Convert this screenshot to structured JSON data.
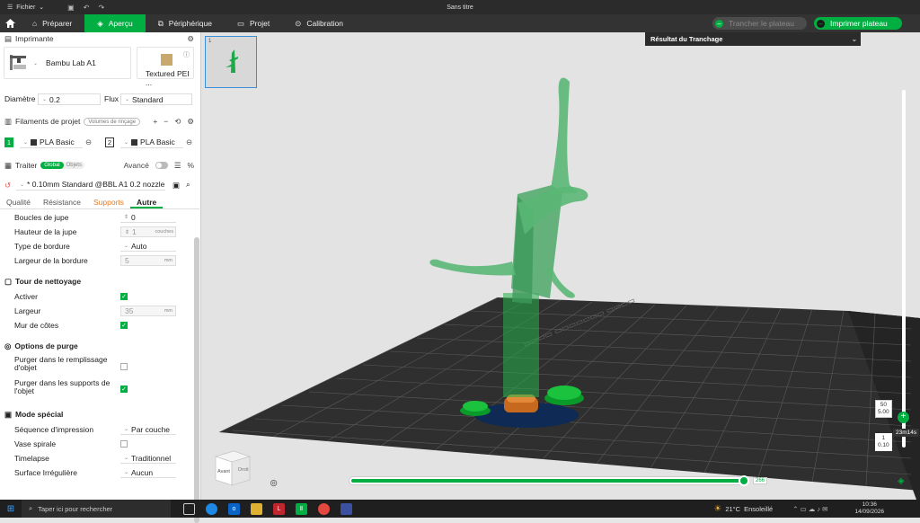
{
  "titlebar": {
    "file_menu": "Fichier",
    "window_title": "Sans titre"
  },
  "nav": {
    "tabs": [
      {
        "label": "Préparer",
        "icon": "prepare-icon"
      },
      {
        "label": "Aperçu",
        "icon": "preview-icon",
        "active": true
      },
      {
        "label": "Périphérique",
        "icon": "device-icon"
      },
      {
        "label": "Projet",
        "icon": "project-icon"
      },
      {
        "label": "Calibration",
        "icon": "calibration-icon"
      }
    ],
    "slice_button": "Trancher le plateau",
    "print_button": "Imprimer plateau"
  },
  "printer": {
    "section_title": "Imprimante",
    "printer_name": "Bambu Lab A1",
    "plate_name": "Textured PEI ...",
    "diameter_label": "Diamètre",
    "diameter_value": "0.2",
    "flow_label": "Flux",
    "flow_value": "Standard"
  },
  "filaments": {
    "section_title": "Filaments de projet",
    "flush_pill": "Volumes de rinçage",
    "slots": [
      {
        "num": "1",
        "name": "PLA Basic",
        "color": "#00ae42"
      },
      {
        "num": "2",
        "name": "PLA Basic",
        "color": "#ffffff"
      }
    ]
  },
  "process": {
    "section_title": "Traiter",
    "toggle_global": "Global",
    "toggle_objects": "Objets",
    "advanced_label": "Avancé",
    "profile": "* 0.10mm Standard @BBL A1 0.2 nozzle"
  },
  "tabs": [
    "Qualité",
    "Résistance",
    "Supports",
    "Autre"
  ],
  "settings": {
    "skirt_loops_label": "Boucles de jupe",
    "skirt_loops_value": "0",
    "skirt_height_label": "Hauteur de la jupe",
    "skirt_height_value": "1",
    "skirt_height_unit": "couches",
    "brim_type_label": "Type de bordure",
    "brim_type_value": "Auto",
    "brim_width_label": "Largeur de la bordure",
    "brim_width_value": "5",
    "brim_width_unit": "mm",
    "prime_tower_title": "Tour de nettoyage",
    "enable_label": "Activer",
    "width_label": "Largeur",
    "width_value": "35",
    "width_unit": "mm",
    "rib_wall_label": "Mur de côtes",
    "purge_title": "Options de purge",
    "purge_infill_label_1": "Purger dans le remplissage",
    "purge_infill_label_2": "d'objet",
    "purge_support_label_1": "Purger dans les supports de",
    "purge_support_label_2": "l'objet",
    "special_title": "Mode spécial",
    "sequence_label": "Séquence d'impression",
    "sequence_value": "Par couche",
    "spiral_label": "Vase spirale",
    "timelapse_label": "Timelapse",
    "timelapse_value": "Traditionnel",
    "fuzzy_label": "Surface Irrégulière",
    "fuzzy_value": "Aucun"
  },
  "viewport": {
    "thumb_number": "1",
    "slice_result_title": "Résultat du Tranchage",
    "layer_top_1": "50",
    "layer_top_2": "5.00",
    "time_badge": "23m14s",
    "layer_bottom_1": "1",
    "layer_bottom_2": "0.10",
    "h_value": "266",
    "cube_label_1": "Avant",
    "cube_label_2": "Droit"
  },
  "taskbar": {
    "search": "Taper ici pour rechercher",
    "temp": "21°C",
    "weather": "Ensoleillé",
    "time": "10:36",
    "date": "14/09/2026"
  }
}
